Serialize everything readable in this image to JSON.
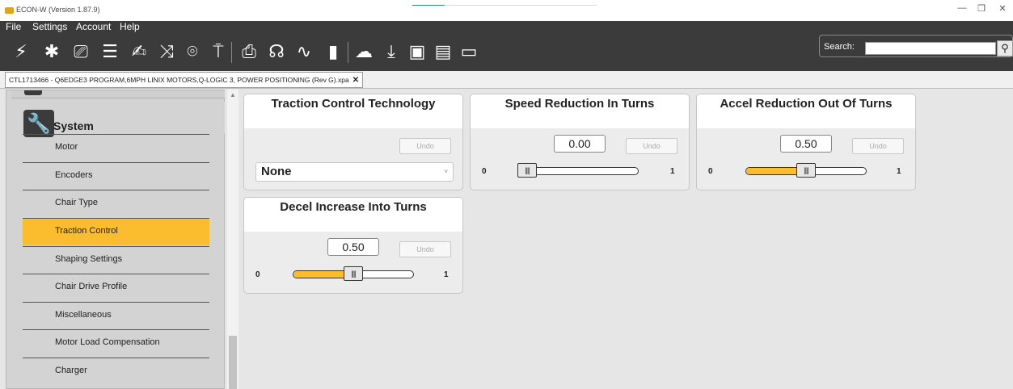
{
  "window": {
    "title": "ECON-W (Version 1.87.9)",
    "minimize_glyph": "—",
    "maximize_glyph": "❐",
    "close_glyph": "✕"
  },
  "menu": [
    "File",
    "Settings",
    "Account",
    "Help"
  ],
  "toolbar": {
    "icons": [
      {
        "name": "connect-icon",
        "glyph": "⚡"
      },
      {
        "name": "bluetooth-icon",
        "glyph": "✱"
      },
      {
        "name": "cast-icon",
        "glyph": "⎚"
      },
      {
        "name": "list-icon",
        "glyph": "☰"
      },
      {
        "name": "pen-icon",
        "glyph": "✍"
      },
      {
        "name": "shuffle-icon",
        "glyph": "⤨"
      },
      {
        "name": "camera-icon",
        "glyph": "⌾"
      },
      {
        "name": "antenna-icon",
        "glyph": "⍑"
      },
      {
        "name": "monitor-icon",
        "glyph": "⎙"
      },
      {
        "name": "stethoscope-icon",
        "glyph": "☊"
      },
      {
        "name": "pulse-icon",
        "glyph": "∿"
      },
      {
        "name": "battery-icon",
        "glyph": "▮"
      },
      {
        "name": "cloud-icon",
        "glyph": "☁"
      },
      {
        "name": "download-icon",
        "glyph": "⤓"
      },
      {
        "name": "image-icon",
        "glyph": "▣"
      },
      {
        "name": "clipboard-icon",
        "glyph": "▤"
      },
      {
        "name": "message-icon",
        "glyph": "▭"
      }
    ],
    "search_label": "Search:",
    "search_value": "",
    "search_icon_glyph": "⚲"
  },
  "tab": {
    "label": "CTL1713466 - Q6EDGE3 PROGRAM,6MPH LINIX MOTORS,Q-LOGIC 3, POWER POSITIONING (Rev G).xpa",
    "close_glyph": "✕"
  },
  "sidebar": {
    "section_title": "System",
    "section_icon_glyph": "🔧",
    "items": [
      {
        "label": "Motor"
      },
      {
        "label": "Encoders"
      },
      {
        "label": "Chair Type"
      },
      {
        "label": "Traction Control",
        "active": true
      },
      {
        "label": "Shaping Settings"
      },
      {
        "label": "Chair Drive Profile"
      },
      {
        "label": "Miscellaneous"
      },
      {
        "label": "Motor Load Compensation"
      },
      {
        "label": "Charger"
      }
    ]
  },
  "cards": {
    "traction": {
      "title": "Traction Control Technology",
      "undo": "Undo",
      "selected": "None",
      "chevron": "˅"
    },
    "speed": {
      "title": "Speed Reduction In Turns",
      "undo": "Undo",
      "value": "0.00",
      "level": 0.0,
      "min": "0",
      "max": "1"
    },
    "accel": {
      "title": "Accel Reduction Out Of Turns",
      "undo": "Undo",
      "value": "0.50",
      "level": 0.5,
      "min": "0",
      "max": "1"
    },
    "decel": {
      "title": "Decel Increase Into Turns",
      "undo": "Undo",
      "value": "0.50",
      "level": 0.5,
      "min": "0",
      "max": "1"
    }
  },
  "knob_glyph": "||||",
  "colors": {
    "accent": "#fbbd2e",
    "toolbar_bg": "#3b3b3b",
    "sidebar_bg": "#d3d3d3",
    "content_bg": "#e6e6e6"
  }
}
